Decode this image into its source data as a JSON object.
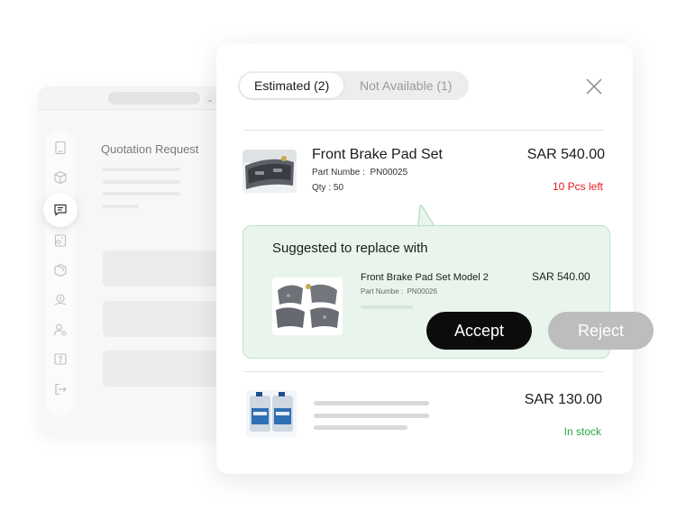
{
  "background_window": {
    "title": "Quotation Request",
    "chevron": "⌄",
    "rail_icons": [
      "document-icon",
      "box-icon",
      "chat-icon",
      "invoice-icon",
      "package-icon",
      "money-icon",
      "user-settings-icon",
      "help-icon",
      "logout-icon"
    ],
    "active_icon": "chat-icon"
  },
  "tabs": [
    {
      "label": "Estimated (2)",
      "active": true
    },
    {
      "label": "Not Available (1)",
      "active": false
    }
  ],
  "items": [
    {
      "name": "Front Brake Pad Set",
      "part_label": "Part Numbe :",
      "part_number": "PN00025",
      "qty_label": "Qty :",
      "qty": "50",
      "price": "SAR 540.00",
      "stock": "10 Pcs left"
    },
    {
      "price": "SAR 130.00",
      "stock": "In stock"
    }
  ],
  "suggestion": {
    "title": "Suggested to replace with",
    "name": "Front Brake Pad Set Model 2",
    "part_label": "Part Numbe :",
    "part_number": "PN00026",
    "price": "SAR 540.00",
    "accept_label": "Accept",
    "reject_label": "Reject"
  },
  "colors": {
    "accent_dark": "#0c0c0c",
    "reject_gray": "#bdbdbd",
    "stock_low": "#e21b1b",
    "stock_ok": "#28a745",
    "suggest_bg": "#e9f5ec",
    "suggest_border": "#b9e3c3"
  }
}
